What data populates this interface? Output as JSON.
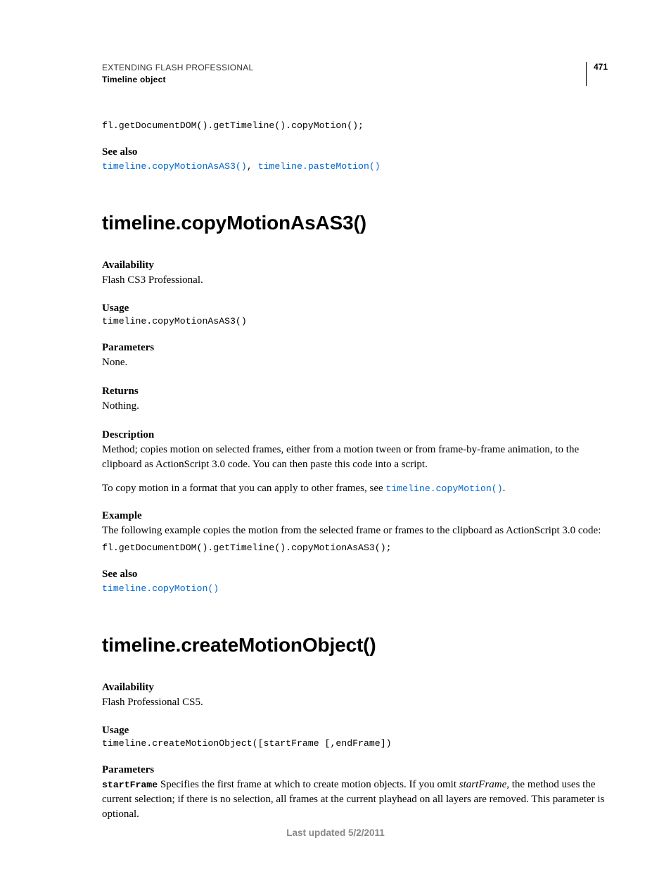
{
  "header": {
    "book": "EXTENDING FLASH PROFESSIONAL",
    "chapter": "Timeline object",
    "page_number": "471"
  },
  "intro": {
    "code": "fl.getDocumentDOM().getTimeline().copyMotion();",
    "see_also_label": "See also",
    "see_also_links": [
      "timeline.copyMotionAsAS3()",
      "timeline.pasteMotion()"
    ]
  },
  "section1": {
    "title": "timeline.copyMotionAsAS3()",
    "availability_label": "Availability",
    "availability_text": "Flash CS3 Professional.",
    "usage_label": "Usage",
    "usage_code": "timeline.copyMotionAsAS3()",
    "parameters_label": "Parameters",
    "parameters_text": "None.",
    "returns_label": "Returns",
    "returns_text": "Nothing.",
    "description_label": "Description",
    "description_text": "Method; copies motion on selected frames, either from a motion tween or from frame-by-frame animation, to the clipboard as ActionScript 3.0 code. You can then paste this code into a script.",
    "description_text2_pre": "To copy motion in a format that you can apply to other frames, see ",
    "description_link": "timeline.copyMotion()",
    "description_text2_post": ".",
    "example_label": "Example",
    "example_text": "The following example copies the motion from the selected frame or frames to the clipboard as ActionScript 3.0 code:",
    "example_code": "fl.getDocumentDOM().getTimeline().copyMotionAsAS3();",
    "see_also_label": "See also",
    "see_also_link": "timeline.copyMotion()"
  },
  "section2": {
    "title": "timeline.createMotionObject()",
    "availability_label": "Availability",
    "availability_text": "Flash Professional CS5.",
    "usage_label": "Usage",
    "usage_code": "timeline.createMotionObject([startFrame [,endFrame])",
    "parameters_label": "Parameters",
    "param1_name": "startFrame",
    "param1_pre": " Specifies the first frame at which to create motion objects. If you omit ",
    "param1_italic": "startFrame",
    "param1_post": ", the method uses the current selection; if there is no selection, all frames at the current playhead on all layers are removed. This parameter is optional."
  },
  "footer": {
    "text": "Last updated 5/2/2011"
  }
}
